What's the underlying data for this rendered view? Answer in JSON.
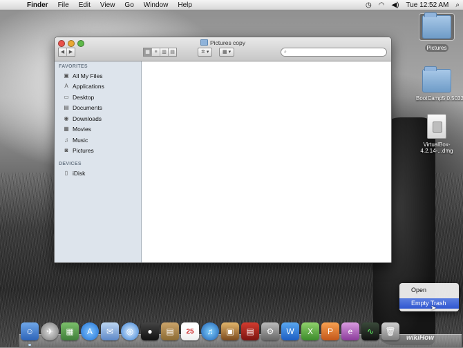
{
  "menubar": {
    "apple_icon": "apple-logo",
    "items": [
      "Finder",
      "File",
      "Edit",
      "View",
      "Go",
      "Window",
      "Help"
    ],
    "clock": "Tue 12:52 AM"
  },
  "desktop": {
    "icons": [
      {
        "label": "Pictures",
        "kind": "folder"
      },
      {
        "label": "BootCamp5.0.5033",
        "kind": "folder"
      },
      {
        "label": "VirtualBox-4.2.14-...dmg",
        "kind": "disk-image"
      }
    ]
  },
  "window": {
    "title": "Pictures copy",
    "search_placeholder": "",
    "sidebar": {
      "favorites_header": "FAVORITES",
      "favorites": [
        {
          "label": "All My Files",
          "icon": "all-files-icon"
        },
        {
          "label": "Applications",
          "icon": "applications-icon"
        },
        {
          "label": "Desktop",
          "icon": "desktop-icon"
        },
        {
          "label": "Documents",
          "icon": "documents-icon"
        },
        {
          "label": "Downloads",
          "icon": "downloads-icon"
        },
        {
          "label": "Movies",
          "icon": "movies-icon"
        },
        {
          "label": "Music",
          "icon": "music-icon"
        },
        {
          "label": "Pictures",
          "icon": "pictures-icon"
        }
      ],
      "devices_header": "DEVICES",
      "devices": [
        {
          "label": "iDisk",
          "icon": "idisk-icon"
        }
      ]
    }
  },
  "context_menu": {
    "items": [
      "Open",
      "Empty Trash"
    ],
    "highlighted": "Empty Trash"
  },
  "watermark": "wikiHow",
  "colors": {
    "menu_highlight": "#3a62d6",
    "sidebar_bg": "#dde4ec"
  }
}
